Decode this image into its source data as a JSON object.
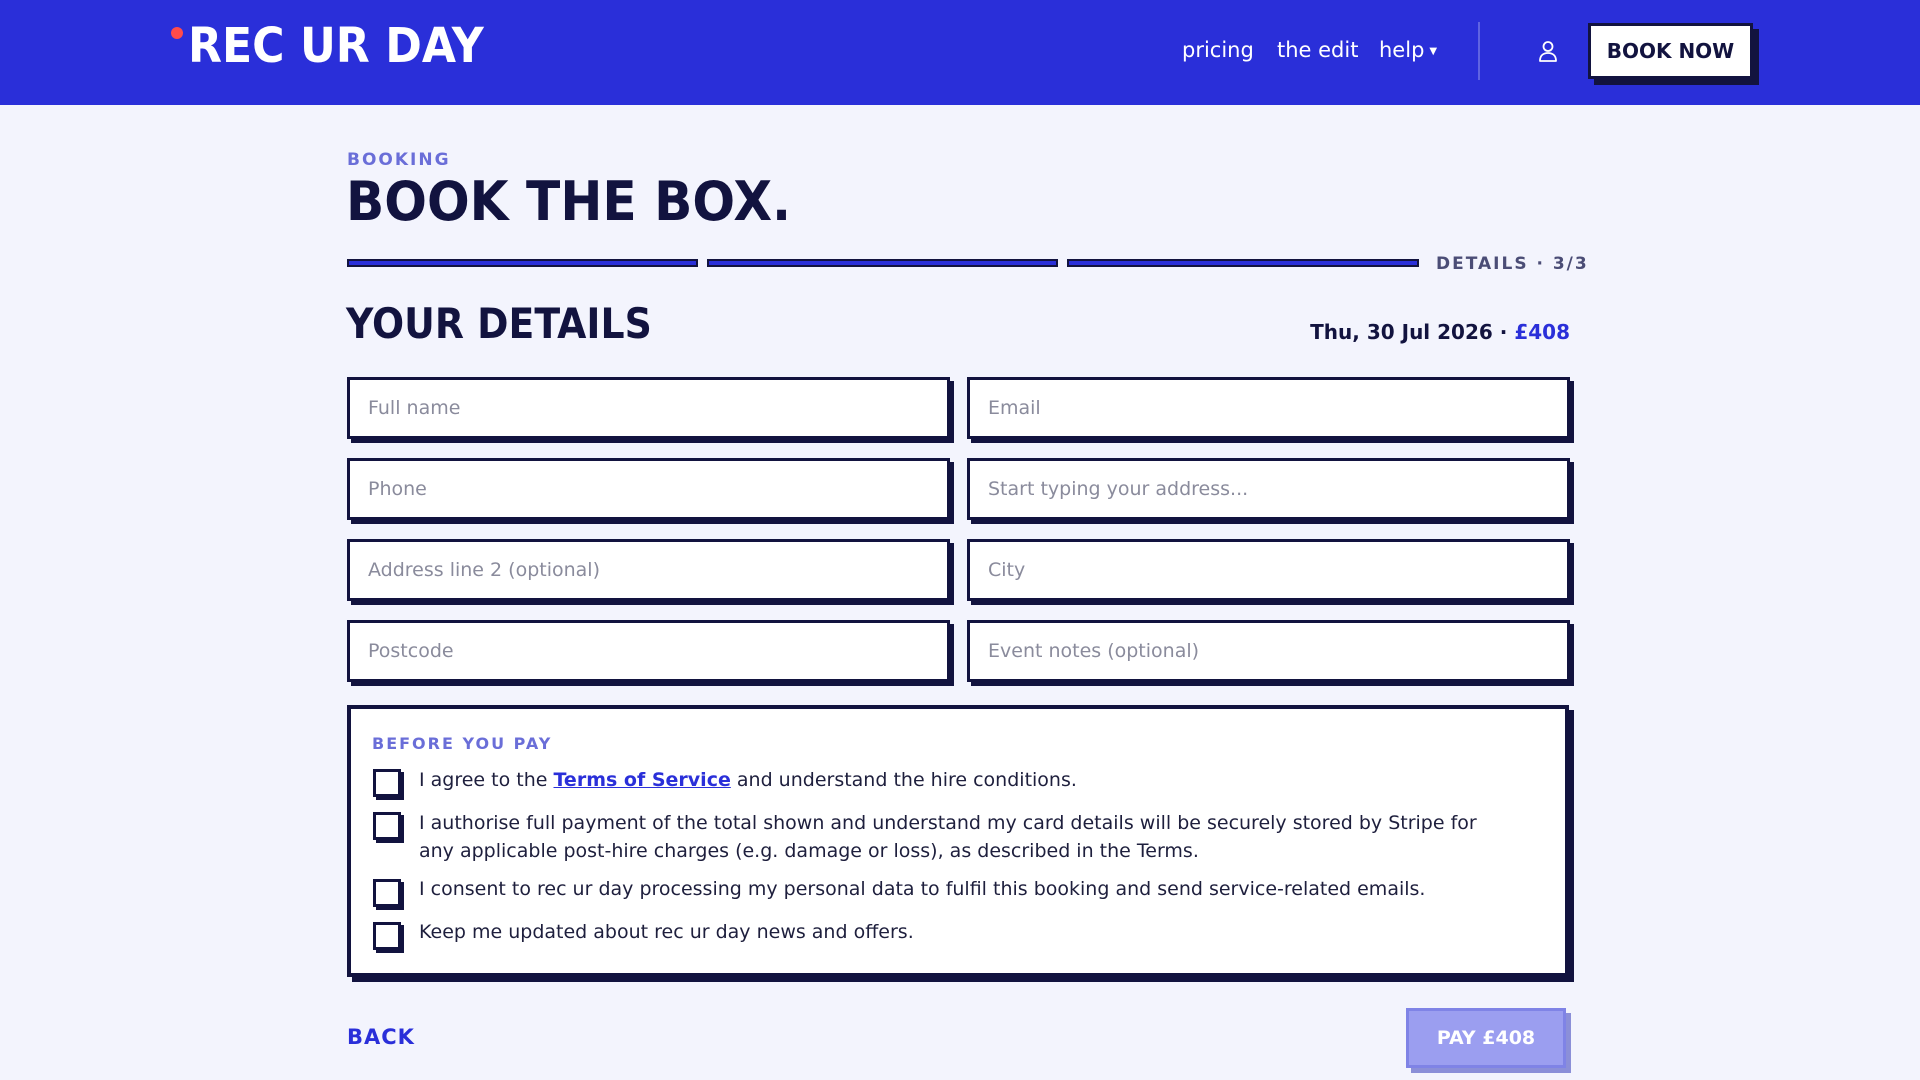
{
  "header": {
    "logo": "REC UR DAY",
    "nav": {
      "pricing": "pricing",
      "the_edit": "the edit",
      "help": "help"
    },
    "book_now": "BOOK NOW"
  },
  "page": {
    "eyebrow": "BOOKING",
    "title": "BOOK THE BOX.",
    "step_label": "DETAILS · 3/3",
    "steps_completed": 3,
    "steps_total": 3
  },
  "details": {
    "title": "YOUR DETAILS",
    "summary_date": "Thu, 30 Jul 2026",
    "summary_sep": " · ",
    "summary_price": "£408"
  },
  "form": {
    "full_name": {
      "placeholder": "Full name",
      "value": ""
    },
    "email": {
      "placeholder": "Email",
      "value": ""
    },
    "phone": {
      "placeholder": "Phone",
      "value": ""
    },
    "address": {
      "placeholder": "Start typing your address...",
      "value": ""
    },
    "address2": {
      "placeholder": "Address line 2 (optional)",
      "value": ""
    },
    "city": {
      "placeholder": "City",
      "value": ""
    },
    "postcode": {
      "placeholder": "Postcode",
      "value": ""
    },
    "notes": {
      "placeholder": "Event notes (optional)",
      "value": ""
    }
  },
  "consent": {
    "title": "BEFORE YOU PAY",
    "terms_before": "I agree to the ",
    "terms_link": "Terms of Service",
    "terms_after": " and understand the hire conditions.",
    "payment": "I authorise full payment of the total shown and understand my card details will be securely stored by Stripe for any applicable post-hire charges (e.g. damage or loss), as described in the Terms.",
    "data": "I consent to rec ur day processing my personal data to fulfil this booking and send service-related emails.",
    "marketing": "Keep me updated about rec ur day news and offers."
  },
  "actions": {
    "back": "BACK",
    "pay": "PAY £408"
  },
  "colors": {
    "brand": "#2a2fd9",
    "ink": "#12133f",
    "background": "#f3f4fd",
    "logo_dot": "#ff4b4b",
    "pay_disabled": "#9b9ef0"
  },
  "icons": {
    "account": "user-icon",
    "help_caret": "caret-down-icon"
  }
}
